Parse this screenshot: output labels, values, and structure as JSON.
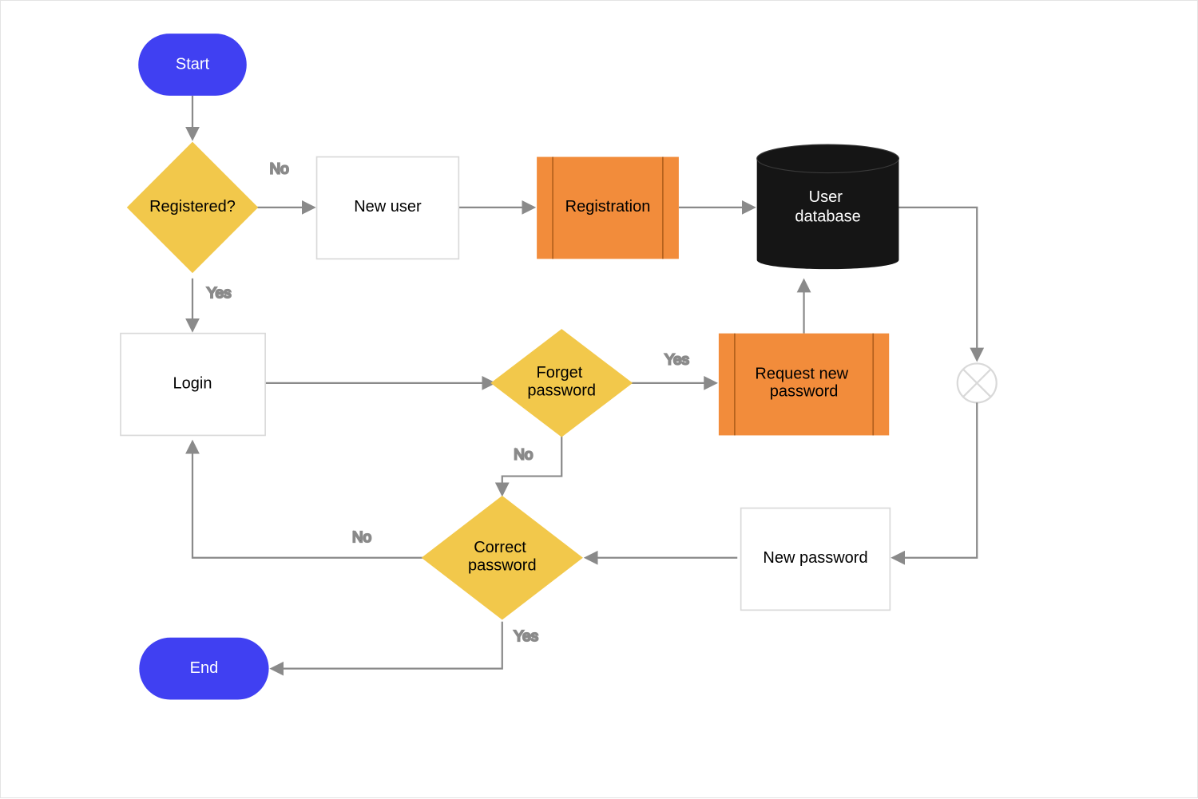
{
  "colors": {
    "terminator": "#4040F2",
    "decision": "#F2C84B",
    "process_accent": "#F28C3B",
    "process_plain_fill": "#FFFFFF",
    "database": "#151515",
    "stroke": "#8A8A8A",
    "stroke_light": "#D9D9D9",
    "edge": "#8A8A8A"
  },
  "nodes": {
    "start": {
      "label": "Start"
    },
    "registered": {
      "label": "Registered?"
    },
    "new_user": {
      "label": "New user"
    },
    "registration": {
      "label": "Registration"
    },
    "database": {
      "label": "User\ndatabase"
    },
    "login": {
      "label": "Login"
    },
    "forget_pw": {
      "label": "Forget\npassword"
    },
    "request_pw": {
      "label": "Request new\npassword"
    },
    "new_password": {
      "label": "New password"
    },
    "correct_pw": {
      "label": "Correct\npassword"
    },
    "end": {
      "label": "End"
    }
  },
  "edge_labels": {
    "registered_no": "No",
    "registered_yes": "Yes",
    "forget_yes": "Yes",
    "forget_no": "No",
    "correct_no": "No",
    "correct_yes": "Yes"
  }
}
